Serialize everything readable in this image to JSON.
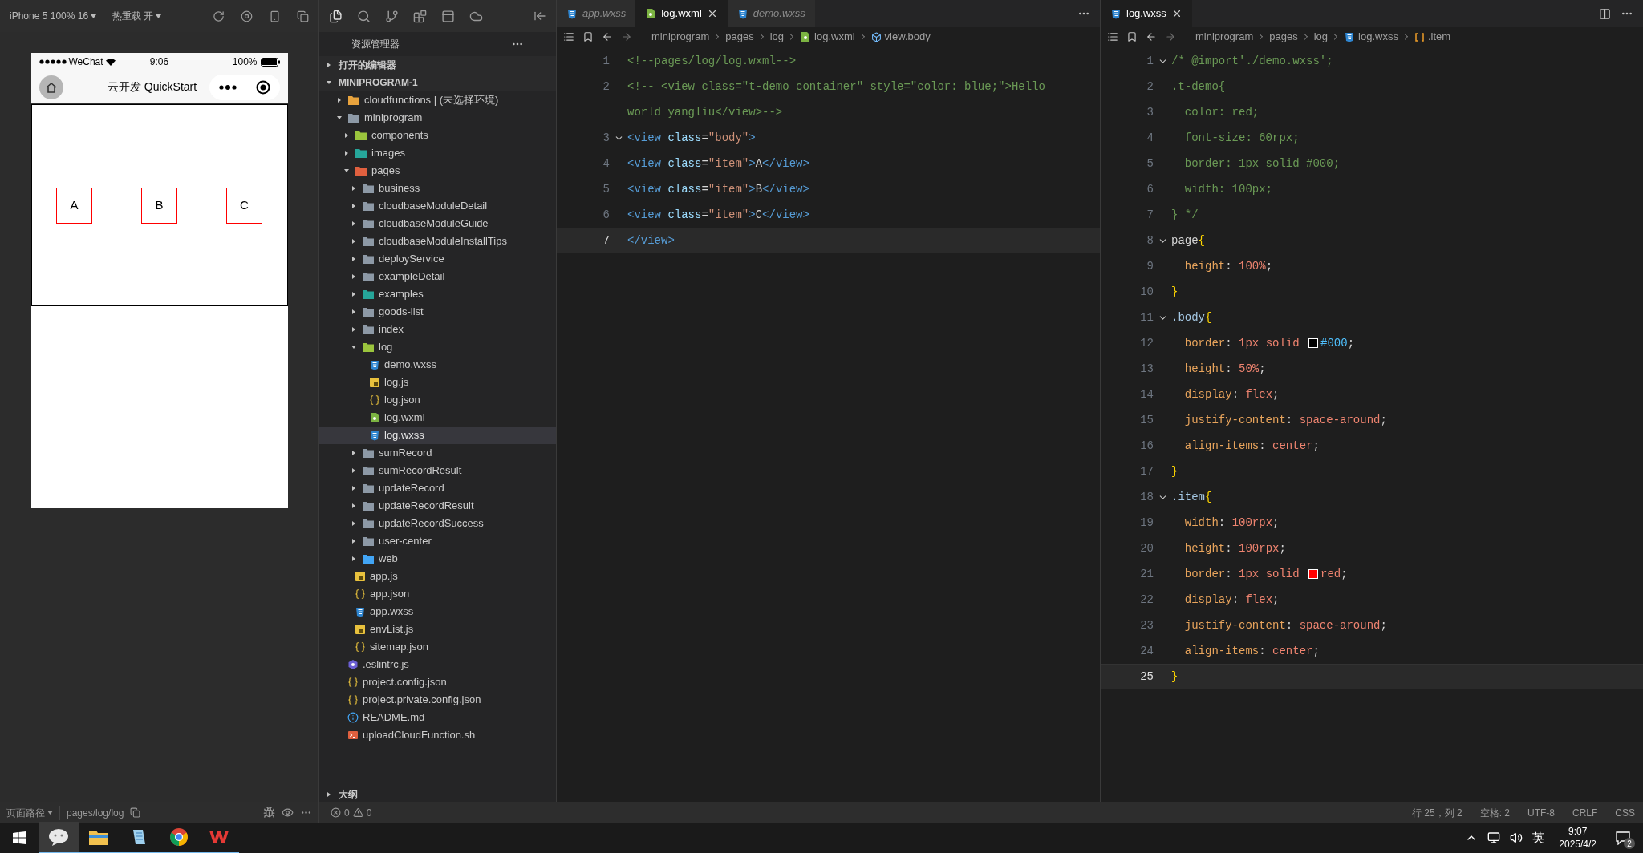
{
  "simulator": {
    "device": "iPhone 5 100% 16",
    "hot_reload": "热重载 开",
    "phone": {
      "carrier": "WeChat",
      "time": "9:06",
      "battery": "100%",
      "title": "云开发 QuickStart",
      "items": [
        "A",
        "B",
        "C"
      ]
    },
    "status": {
      "label": "页面路径",
      "path": "pages/log/log"
    }
  },
  "explorer": {
    "title": "资源管理器",
    "sections": [
      {
        "label": "打开的编辑器",
        "expanded": false
      },
      {
        "label": "MINIPROGRAM-1",
        "expanded": true
      }
    ],
    "tree": [
      {
        "label": "cloudfunctions | (未选择环境)",
        "kind": "folder",
        "color": "#e8a33d",
        "expanded": false,
        "selected": false
      },
      {
        "label": "miniprogram",
        "kind": "folder",
        "color": "#8d99a6",
        "expanded": true,
        "selected": false,
        "children": [
          {
            "label": "components",
            "kind": "folder",
            "color": "#9bc53d",
            "expanded": false,
            "selected": false
          },
          {
            "label": "images",
            "kind": "folder",
            "color": "#26a69a",
            "expanded": false,
            "selected": false
          },
          {
            "label": "pages",
            "kind": "folder",
            "color": "#e0603f",
            "expanded": true,
            "selected": false,
            "children": [
              {
                "label": "business",
                "kind": "folder",
                "color": "#8d99a6",
                "expanded": false,
                "selected": false
              },
              {
                "label": "cloudbaseModuleDetail",
                "kind": "folder",
                "color": "#8d99a6",
                "expanded": false,
                "selected": false
              },
              {
                "label": "cloudbaseModuleGuide",
                "kind": "folder",
                "color": "#8d99a6",
                "expanded": false,
                "selected": false
              },
              {
                "label": "cloudbaseModuleInstallTips",
                "kind": "folder",
                "color": "#8d99a6",
                "expanded": false,
                "selected": false
              },
              {
                "label": "deployService",
                "kind": "folder",
                "color": "#8d99a6",
                "expanded": false,
                "selected": false
              },
              {
                "label": "exampleDetail",
                "kind": "folder",
                "color": "#8d99a6",
                "expanded": false,
                "selected": false
              },
              {
                "label": "examples",
                "kind": "folder",
                "color": "#26a69a",
                "expanded": false,
                "selected": false
              },
              {
                "label": "goods-list",
                "kind": "folder",
                "color": "#8d99a6",
                "expanded": false,
                "selected": false
              },
              {
                "label": "index",
                "kind": "folder",
                "color": "#8d99a6",
                "expanded": false,
                "selected": false
              },
              {
                "label": "log",
                "kind": "folder",
                "color": "#9bc53d",
                "expanded": true,
                "selected": false,
                "children": [
                  {
                    "label": "demo.wxss",
                    "kind": "css",
                    "selected": false
                  },
                  {
                    "label": "log.js",
                    "kind": "js",
                    "selected": false
                  },
                  {
                    "label": "log.json",
                    "kind": "json",
                    "selected": false
                  },
                  {
                    "label": "log.wxml",
                    "kind": "wxml",
                    "selected": false
                  },
                  {
                    "label": "log.wxss",
                    "kind": "css",
                    "selected": true
                  }
                ]
              },
              {
                "label": "sumRecord",
                "kind": "folder",
                "color": "#8d99a6",
                "expanded": false,
                "selected": false
              },
              {
                "label": "sumRecordResult",
                "kind": "folder",
                "color": "#8d99a6",
                "expanded": false,
                "selected": false
              },
              {
                "label": "updateRecord",
                "kind": "folder",
                "color": "#8d99a6",
                "expanded": false,
                "selected": false
              },
              {
                "label": "updateRecordResult",
                "kind": "folder",
                "color": "#8d99a6",
                "expanded": false,
                "selected": false
              },
              {
                "label": "updateRecordSuccess",
                "kind": "folder",
                "color": "#8d99a6",
                "expanded": false,
                "selected": false
              },
              {
                "label": "user-center",
                "kind": "folder",
                "color": "#8d99a6",
                "expanded": false,
                "selected": false
              },
              {
                "label": "web",
                "kind": "folder",
                "color": "#42a5f5",
                "expanded": false,
                "selected": false
              }
            ]
          },
          {
            "label": "app.js",
            "kind": "js",
            "selected": false
          },
          {
            "label": "app.json",
            "kind": "json",
            "selected": false
          },
          {
            "label": "app.wxss",
            "kind": "css",
            "selected": false
          },
          {
            "label": "envList.js",
            "kind": "js",
            "selected": false
          },
          {
            "label": "sitemap.json",
            "kind": "json",
            "selected": false
          }
        ]
      },
      {
        "label": ".eslintrc.js",
        "kind": "eslint",
        "selected": false
      },
      {
        "label": "project.config.json",
        "kind": "json",
        "selected": false
      },
      {
        "label": "project.private.config.json",
        "kind": "json",
        "selected": false
      },
      {
        "label": "README.md",
        "kind": "info",
        "selected": false
      },
      {
        "label": "uploadCloudFunction.sh",
        "kind": "sh",
        "selected": false
      }
    ],
    "outline": {
      "label": "大纲",
      "expanded": false
    },
    "problems": {
      "errors": "0",
      "warnings": "0"
    }
  },
  "editors": [
    {
      "tabs": [
        {
          "label": "app.wxss",
          "kind": "css",
          "selected": false,
          "preview": true
        },
        {
          "label": "log.wxml",
          "kind": "wxml",
          "selected": true,
          "preview": false
        },
        {
          "label": "demo.wxss",
          "kind": "css",
          "selected": false,
          "preview": true
        }
      ],
      "breadcrumb": [
        {
          "label": "miniprogram",
          "kind": "text"
        },
        {
          "label": "pages",
          "kind": "text"
        },
        {
          "label": "log",
          "kind": "text"
        },
        {
          "label": "log.wxml",
          "kind": "wxml"
        },
        {
          "label": "view.body",
          "kind": "element"
        }
      ],
      "lines": [
        {
          "n": "1",
          "fold": false,
          "current": false,
          "tokens": [
            {
              "kind": "comment",
              "t": "<!--pages/log/log.wxml-->"
            }
          ]
        },
        {
          "n": "2",
          "fold": false,
          "current": false,
          "tokens": [
            {
              "kind": "comment",
              "t": "<!-- <view class=\"t-demo container\" style=\"color: blue;\">Hello"
            }
          ],
          "wrapped": [
            {
              "kind": "comment",
              "t": "world yangliu</view>-->"
            }
          ]
        },
        {
          "n": "3",
          "fold": true,
          "current": false,
          "tokens": [
            {
              "kind": "tag",
              "t": "<view"
            },
            {
              "kind": "attr",
              "t": " class"
            },
            {
              "kind": "punct",
              "t": "="
            },
            {
              "kind": "string",
              "t": "\"body\""
            },
            {
              "kind": "tag",
              "t": ">"
            }
          ]
        },
        {
          "n": "4",
          "fold": false,
          "current": false,
          "tokens": [
            {
              "kind": "tag",
              "t": "<view"
            },
            {
              "kind": "attr",
              "t": " class"
            },
            {
              "kind": "punct",
              "t": "="
            },
            {
              "kind": "string",
              "t": "\"item\""
            },
            {
              "kind": "tag",
              "t": ">"
            },
            {
              "kind": "text",
              "t": "A"
            },
            {
              "kind": "tag",
              "t": "</view>"
            }
          ]
        },
        {
          "n": "5",
          "fold": false,
          "current": false,
          "tokens": [
            {
              "kind": "tag",
              "t": "<view"
            },
            {
              "kind": "attr",
              "t": " class"
            },
            {
              "kind": "punct",
              "t": "="
            },
            {
              "kind": "string",
              "t": "\"item\""
            },
            {
              "kind": "tag",
              "t": ">"
            },
            {
              "kind": "text",
              "t": "B"
            },
            {
              "kind": "tag",
              "t": "</view>"
            }
          ]
        },
        {
          "n": "6",
          "fold": false,
          "current": false,
          "tokens": [
            {
              "kind": "tag",
              "t": "<view"
            },
            {
              "kind": "attr",
              "t": " class"
            },
            {
              "kind": "punct",
              "t": "="
            },
            {
              "kind": "string",
              "t": "\"item\""
            },
            {
              "kind": "tag",
              "t": ">"
            },
            {
              "kind": "text",
              "t": "C"
            },
            {
              "kind": "tag",
              "t": "</view>"
            }
          ]
        },
        {
          "n": "7",
          "fold": false,
          "current": true,
          "tokens": [
            {
              "kind": "tag",
              "t": "</view>"
            }
          ]
        }
      ]
    },
    {
      "tabs": [
        {
          "label": "log.wxss",
          "kind": "css",
          "selected": true,
          "preview": false
        }
      ],
      "breadcrumb": [
        {
          "label": "miniprogram",
          "kind": "text"
        },
        {
          "label": "pages",
          "kind": "text"
        },
        {
          "label": "log",
          "kind": "text"
        },
        {
          "label": "log.wxss",
          "kind": "css"
        },
        {
          "label": ".item",
          "kind": "class"
        }
      ],
      "lines": [
        {
          "n": "1",
          "fold": true,
          "current": false,
          "tokens": [
            {
              "kind": "comment",
              "t": "/* @import'./demo.wxss';"
            }
          ]
        },
        {
          "n": "2",
          "fold": false,
          "current": false,
          "tokens": [
            {
              "kind": "comment",
              "t": ".t-demo{"
            }
          ]
        },
        {
          "n": "3",
          "fold": false,
          "current": false,
          "tokens": [
            {
              "kind": "comment",
              "t": "  color: red;"
            }
          ]
        },
        {
          "n": "4",
          "fold": false,
          "current": false,
          "tokens": [
            {
              "kind": "comment",
              "t": "  font-size: 60rpx;"
            }
          ]
        },
        {
          "n": "5",
          "fold": false,
          "current": false,
          "tokens": [
            {
              "kind": "comment",
              "t": "  border: 1px solid #000;"
            }
          ]
        },
        {
          "n": "6",
          "fold": false,
          "current": false,
          "tokens": [
            {
              "kind": "comment",
              "t": "  width: 100px;"
            }
          ]
        },
        {
          "n": "7",
          "fold": false,
          "current": false,
          "tokens": [
            {
              "kind": "comment",
              "t": "} */"
            }
          ]
        },
        {
          "n": "8",
          "fold": true,
          "current": false,
          "tokens": [
            {
              "kind": "element",
              "t": "page"
            },
            {
              "kind": "brace",
              "t": "{"
            }
          ]
        },
        {
          "n": "9",
          "fold": false,
          "current": false,
          "tokens": [
            {
              "kind": "prop",
              "t": "  height"
            },
            {
              "kind": "punct",
              "t": ": "
            },
            {
              "kind": "value",
              "t": "100%"
            },
            {
              "kind": "punct",
              "t": ";"
            }
          ]
        },
        {
          "n": "10",
          "fold": false,
          "current": false,
          "tokens": [
            {
              "kind": "brace",
              "t": "}"
            }
          ]
        },
        {
          "n": "11",
          "fold": true,
          "current": false,
          "tokens": [
            {
              "kind": "class",
              "t": ".body"
            },
            {
              "kind": "brace",
              "t": "{"
            }
          ]
        },
        {
          "n": "12",
          "fold": false,
          "current": false,
          "tokens": [
            {
              "kind": "prop",
              "t": "  border"
            },
            {
              "kind": "punct",
              "t": ": "
            },
            {
              "kind": "value",
              "t": "1px solid "
            },
            {
              "kind": "swatch",
              "color": "#000000"
            },
            {
              "kind": "hex",
              "t": "#000"
            },
            {
              "kind": "punct",
              "t": ";"
            }
          ]
        },
        {
          "n": "13",
          "fold": false,
          "current": false,
          "tokens": [
            {
              "kind": "prop",
              "t": "  height"
            },
            {
              "kind": "punct",
              "t": ": "
            },
            {
              "kind": "value",
              "t": "50%"
            },
            {
              "kind": "punct",
              "t": ";"
            }
          ]
        },
        {
          "n": "14",
          "fold": false,
          "current": false,
          "tokens": [
            {
              "kind": "prop",
              "t": "  display"
            },
            {
              "kind": "punct",
              "t": ": "
            },
            {
              "kind": "value",
              "t": "flex"
            },
            {
              "kind": "punct",
              "t": ";"
            }
          ]
        },
        {
          "n": "15",
          "fold": false,
          "current": false,
          "tokens": [
            {
              "kind": "prop",
              "t": "  justify-content"
            },
            {
              "kind": "punct",
              "t": ": "
            },
            {
              "kind": "value",
              "t": "space-around"
            },
            {
              "kind": "punct",
              "t": ";"
            }
          ]
        },
        {
          "n": "16",
          "fold": false,
          "current": false,
          "tokens": [
            {
              "kind": "prop",
              "t": "  align-items"
            },
            {
              "kind": "punct",
              "t": ": "
            },
            {
              "kind": "value",
              "t": "center"
            },
            {
              "kind": "punct",
              "t": ";"
            }
          ]
        },
        {
          "n": "17",
          "fold": false,
          "current": false,
          "tokens": [
            {
              "kind": "brace",
              "t": "}"
            }
          ]
        },
        {
          "n": "18",
          "fold": true,
          "current": false,
          "tokens": [
            {
              "kind": "class",
              "t": ".item"
            },
            {
              "kind": "brace",
              "t": "{"
            }
          ]
        },
        {
          "n": "19",
          "fold": false,
          "current": false,
          "tokens": [
            {
              "kind": "prop",
              "t": "  width"
            },
            {
              "kind": "punct",
              "t": ": "
            },
            {
              "kind": "value",
              "t": "100rpx"
            },
            {
              "kind": "punct",
              "t": ";"
            }
          ]
        },
        {
          "n": "20",
          "fold": false,
          "current": false,
          "tokens": [
            {
              "kind": "prop",
              "t": "  height"
            },
            {
              "kind": "punct",
              "t": ": "
            },
            {
              "kind": "value",
              "t": "100rpx"
            },
            {
              "kind": "punct",
              "t": ";"
            }
          ]
        },
        {
          "n": "21",
          "fold": false,
          "current": false,
          "tokens": [
            {
              "kind": "prop",
              "t": "  border"
            },
            {
              "kind": "punct",
              "t": ": "
            },
            {
              "kind": "value",
              "t": "1px solid "
            },
            {
              "kind": "swatch",
              "color": "#ff0000"
            },
            {
              "kind": "value",
              "t": "red"
            },
            {
              "kind": "punct",
              "t": ";"
            }
          ]
        },
        {
          "n": "22",
          "fold": false,
          "current": false,
          "tokens": [
            {
              "kind": "prop",
              "t": "  display"
            },
            {
              "kind": "punct",
              "t": ": "
            },
            {
              "kind": "value",
              "t": "flex"
            },
            {
              "kind": "punct",
              "t": ";"
            }
          ]
        },
        {
          "n": "23",
          "fold": false,
          "current": false,
          "tokens": [
            {
              "kind": "prop",
              "t": "  justify-content"
            },
            {
              "kind": "punct",
              "t": ": "
            },
            {
              "kind": "value",
              "t": "space-around"
            },
            {
              "kind": "punct",
              "t": ";"
            }
          ]
        },
        {
          "n": "24",
          "fold": false,
          "current": false,
          "tokens": [
            {
              "kind": "prop",
              "t": "  align-items"
            },
            {
              "kind": "punct",
              "t": ": "
            },
            {
              "kind": "value",
              "t": "center"
            },
            {
              "kind": "punct",
              "t": ";"
            }
          ]
        },
        {
          "n": "25",
          "fold": false,
          "current": true,
          "tokens": [
            {
              "kind": "brace",
              "t": "}"
            }
          ]
        }
      ]
    }
  ],
  "status_bar": {
    "cursor": "行 25，列 2",
    "indent": "空格: 2",
    "encoding": "UTF-8",
    "eol": "CRLF",
    "language": "CSS"
  },
  "taskbar": {
    "apps": [
      {
        "kind": "wechat",
        "active": true
      },
      {
        "kind": "files",
        "active": false
      },
      {
        "kind": "notepad",
        "active": false
      },
      {
        "kind": "chrome",
        "active": false
      },
      {
        "kind": "wps",
        "active": false
      }
    ],
    "ime": "英",
    "time": "9:07",
    "date": "2025/4/2",
    "notifications": "2"
  }
}
